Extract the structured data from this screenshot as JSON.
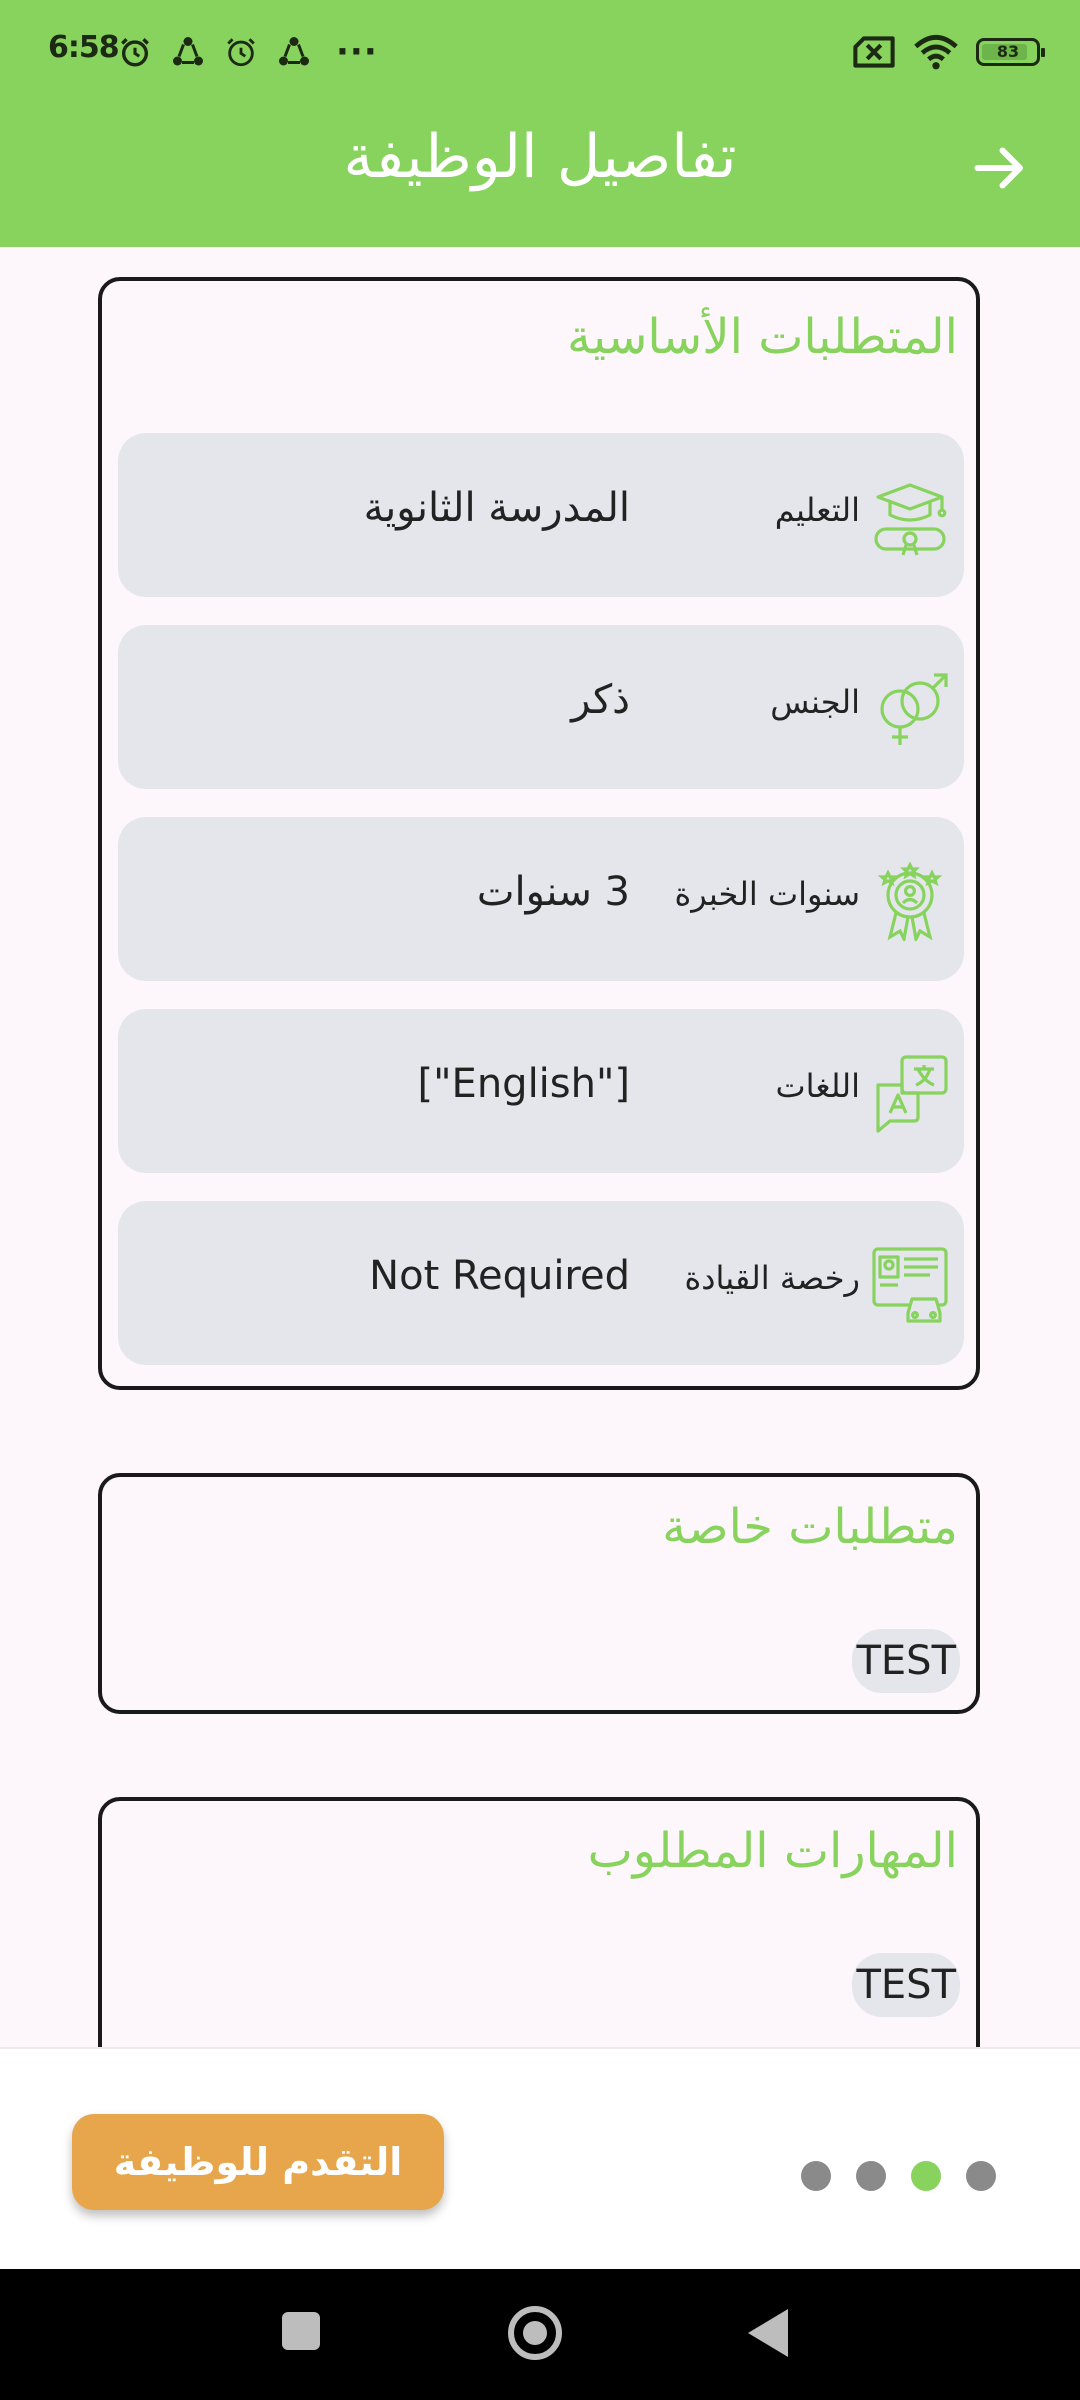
{
  "status_bar": {
    "time": "6:58",
    "battery": "83",
    "more_indicator": "···",
    "icons": [
      "alarm-icon",
      "share-icon",
      "alarm-icon",
      "share-icon",
      "sim-off-icon",
      "wifi-icon",
      "battery-icon"
    ]
  },
  "app_bar": {
    "title": "تفاصيل الوظيفة",
    "back_icon": "arrow-right-icon",
    "color": "#87d35d"
  },
  "basic_requirements": {
    "title": "المتطلبات الأساسية",
    "items": [
      {
        "label": "التعليم",
        "value": "المدرسة الثانوية",
        "icon": "graduation-cap-icon"
      },
      {
        "label": "الجنس",
        "value": "ذكر",
        "icon": "gender-icon"
      },
      {
        "label": "سنوات الخبرة",
        "value": "3 سنوات",
        "icon": "award-badge-icon"
      },
      {
        "label": "اللغات",
        "value": "[\"English\"]",
        "icon": "translate-icon"
      },
      {
        "label": "رخصة القيادة",
        "value": "Not Required",
        "icon": "driving-license-icon"
      }
    ]
  },
  "special_requirements": {
    "title": "متطلبات خاصة",
    "chips": [
      "TEST"
    ]
  },
  "required_skills": {
    "title": "المهارات المطلوب",
    "chips": [
      "TEST"
    ]
  },
  "bottom": {
    "apply_label": "التقدم للوظيفة",
    "apply_color": "#e7a64c",
    "pager_count": 4,
    "pager_active_index": 2
  }
}
